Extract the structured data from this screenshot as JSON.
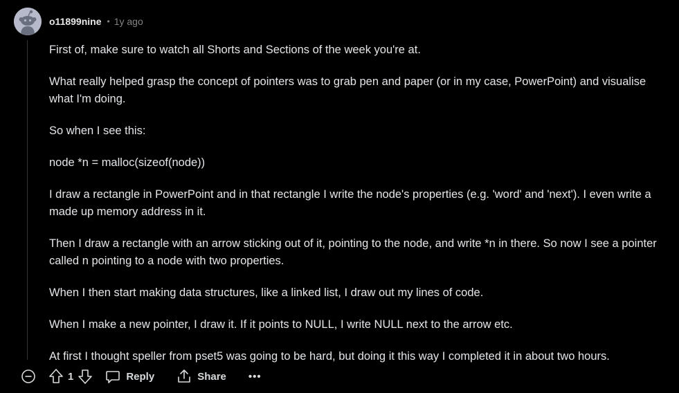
{
  "comment": {
    "author": "o11899nine",
    "separator": "•",
    "time": "1y ago",
    "paragraphs": [
      "First of, make sure to watch all Shorts and Sections of the week you're at.",
      "What really helped grasp the concept of pointers was to grab pen and paper (or in my case, PowerPoint) and visualise what I'm doing.",
      "So when I see this:",
      "node *n = malloc(sizeof(node))",
      "I draw a rectangle in PowerPoint and in that rectangle I write the node's properties (e.g. 'word' and 'next'). I even write a made up memory address in it.",
      "Then I draw a rectangle with an arrow sticking out of it, pointing to the node, and write *n in there. So now I see a pointer called n pointing to a node with two properties.",
      "When I then start making data structures, like a linked list, I draw out my lines of code.",
      "When I make a new pointer, I draw it. If it points to NULL, I write NULL next to the arrow etc.",
      "At first I thought speller from pset5 was going to be hard, but doing it this way I completed it in about two hours."
    ]
  },
  "actions": {
    "vote_count": "1",
    "reply_label": "Reply",
    "share_label": "Share",
    "more_label": "•••"
  },
  "icons": {
    "collapse": "collapse-minus-icon",
    "upvote": "upvote-arrow-icon",
    "downvote": "downvote-arrow-icon",
    "reply": "reply-bubble-icon",
    "share": "share-icon",
    "avatar": "reddit-snoo-avatar"
  },
  "colors": {
    "background": "#000000",
    "text": "#e3e5e8",
    "muted": "#818384",
    "avatar_bg": "#b5b9c9"
  }
}
